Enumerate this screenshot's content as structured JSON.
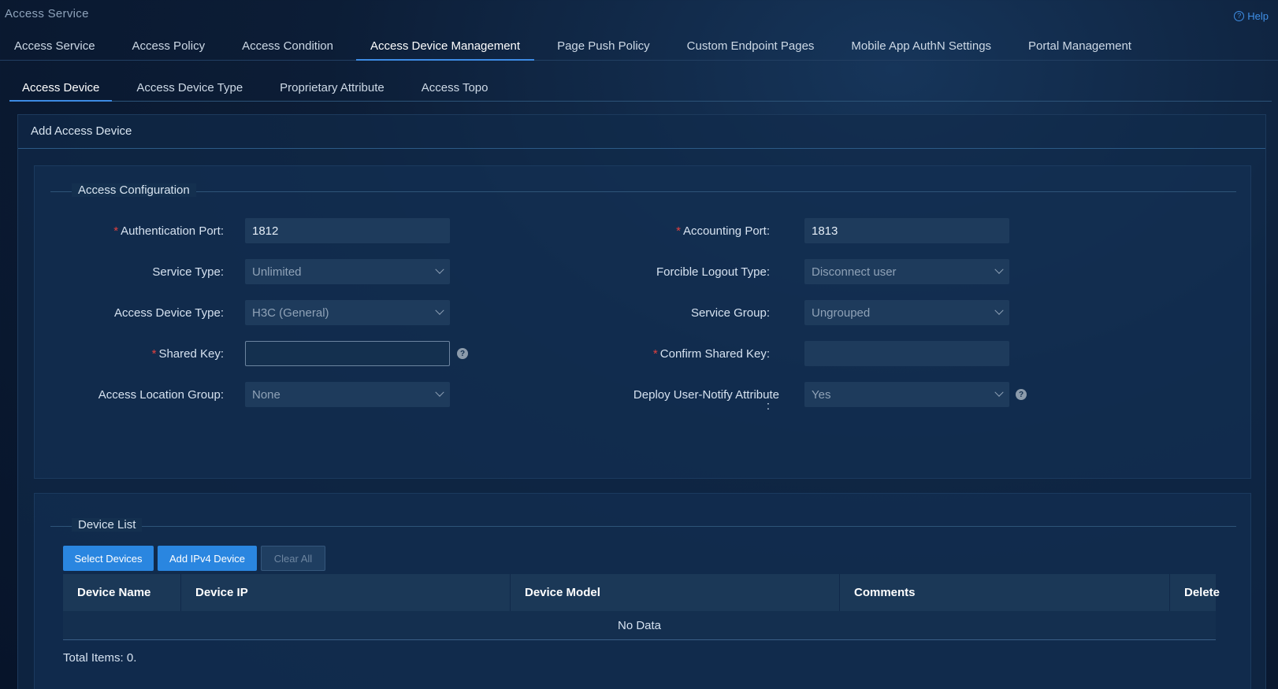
{
  "app": {
    "title": "Access Service",
    "help_label": "Help"
  },
  "main_tabs": [
    {
      "label": "Access Service"
    },
    {
      "label": "Access Policy"
    },
    {
      "label": "Access Condition"
    },
    {
      "label": "Access Device Management"
    },
    {
      "label": "Page Push Policy"
    },
    {
      "label": "Custom Endpoint Pages"
    },
    {
      "label": "Mobile App AuthN Settings"
    },
    {
      "label": "Portal Management"
    }
  ],
  "main_tab_active": "Access Device Management",
  "sub_tabs": [
    {
      "label": "Access Device"
    },
    {
      "label": "Access Device Type"
    },
    {
      "label": "Proprietary Attribute"
    },
    {
      "label": "Access Topo"
    }
  ],
  "sub_tab_active": "Access Device",
  "panel": {
    "title": "Add Access Device"
  },
  "access_config": {
    "legend": "Access Configuration",
    "auth_port": {
      "label": "Authentication Port:",
      "value": "1812"
    },
    "acct_port": {
      "label": "Accounting Port:",
      "value": "1813"
    },
    "service_type": {
      "label": "Service Type:",
      "value": "Unlimited"
    },
    "forcible_logout": {
      "label": "Forcible Logout Type:",
      "value": "Disconnect user"
    },
    "device_type": {
      "label": "Access Device Type:",
      "value": "H3C (General)"
    },
    "service_group": {
      "label": "Service Group:",
      "value": "Ungrouped"
    },
    "shared_key": {
      "label": "Shared Key:",
      "value": ""
    },
    "confirm_key": {
      "label": "Confirm Shared Key:",
      "value": ""
    },
    "location_group": {
      "label": "Access Location Group:",
      "value": "None"
    },
    "user_notify": {
      "label": "Deploy User-Notify Attribute",
      "label_colon": ":",
      "value": "Yes"
    }
  },
  "device_list": {
    "legend": "Device List",
    "buttons": {
      "select": "Select Devices",
      "add_ipv4": "Add IPv4 Device",
      "clear": "Clear All"
    },
    "columns": [
      "Device Name",
      "Device IP",
      "Device Model",
      "Comments",
      "Delete"
    ],
    "empty_text": "No Data",
    "total": "Total Items: 0."
  },
  "colors": {
    "accent": "#2a86e0",
    "required": "#e0413f"
  }
}
